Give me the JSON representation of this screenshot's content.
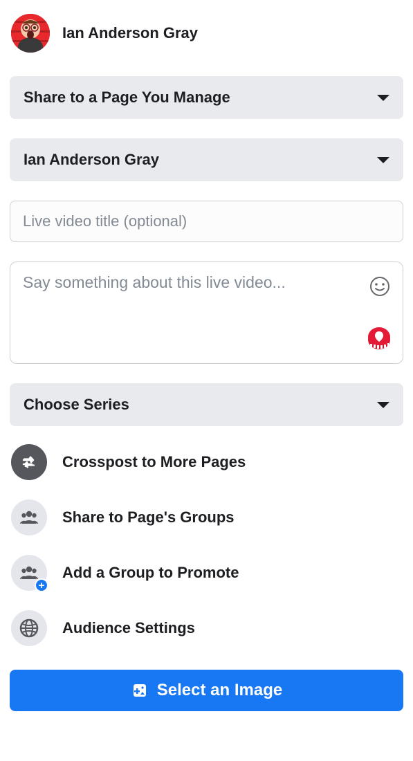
{
  "profile": {
    "name": "Ian Anderson Gray"
  },
  "share_target_dropdown": {
    "label": "Share to a Page You Manage"
  },
  "page_dropdown": {
    "label": "Ian Anderson Gray"
  },
  "title_input": {
    "placeholder": "Live video title (optional)",
    "value": ""
  },
  "description_input": {
    "placeholder": "Say something about this live video...",
    "value": ""
  },
  "series_dropdown": {
    "label": "Choose Series"
  },
  "options": {
    "crosspost": "Crosspost to More Pages",
    "share_groups": "Share to Page's Groups",
    "add_group": "Add a Group to Promote",
    "audience": "Audience Settings"
  },
  "select_image_button": {
    "label": "Select an Image"
  }
}
